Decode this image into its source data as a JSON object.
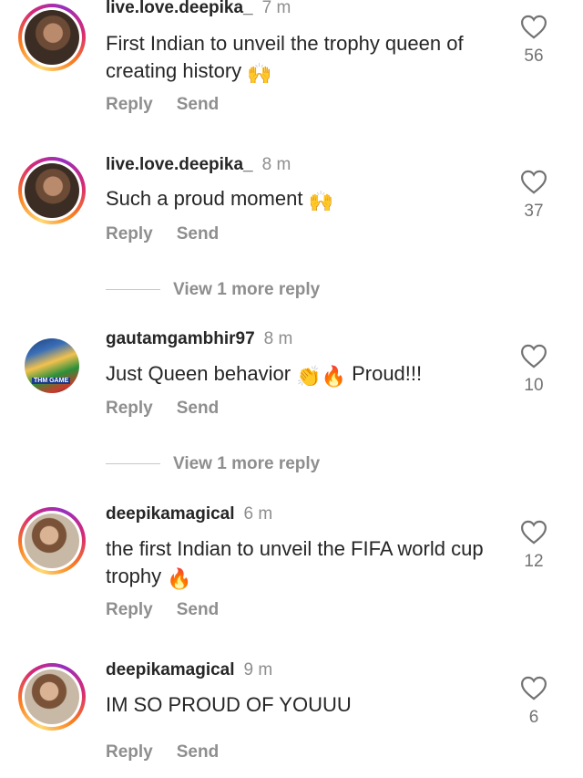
{
  "comments": [
    {
      "username": "live.love.deepika_",
      "time": "7 m",
      "text": "First Indian to unveil the trophy queen of creating history",
      "emoji": "🙌",
      "reply": "Reply",
      "send": "Send",
      "likes": "56",
      "avatar_icon": "profile-photo"
    },
    {
      "username": "live.love.deepika_",
      "time": "8 m",
      "text": "Such a proud moment",
      "emoji": "🙌",
      "reply": "Reply",
      "send": "Send",
      "likes": "37",
      "avatar_icon": "profile-photo"
    },
    {
      "username": "gautamgambhir97",
      "time": "8 m",
      "text": "Just Queen behavior",
      "emoji": "👏🔥",
      "text_after": "Proud!!!",
      "reply": "Reply",
      "send": "Send",
      "likes": "10",
      "avatar_icon": "profile-photo"
    },
    {
      "username": "deepikamagical",
      "time": "6 m",
      "text": "the first Indian to unveil the FIFA world cup trophy",
      "emoji": "🔥",
      "reply": "Reply",
      "send": "Send",
      "likes": "12",
      "avatar_icon": "profile-photo"
    },
    {
      "username": "deepikamagical",
      "time": "9 m",
      "text": "IM SO PROUD OF YOUUU",
      "reply": "Reply",
      "send": "Send",
      "likes": "6",
      "avatar_icon": "profile-photo"
    }
  ],
  "view_more_replies": [
    "View 1 more reply",
    "View 1 more reply"
  ],
  "colors": {
    "text": "#262626",
    "secondary": "#8e8e8e",
    "story_ring": [
      "#feda75",
      "#fa7e1e",
      "#d62976",
      "#962fbf"
    ]
  },
  "icons": {
    "like": "heart-outline-icon"
  }
}
